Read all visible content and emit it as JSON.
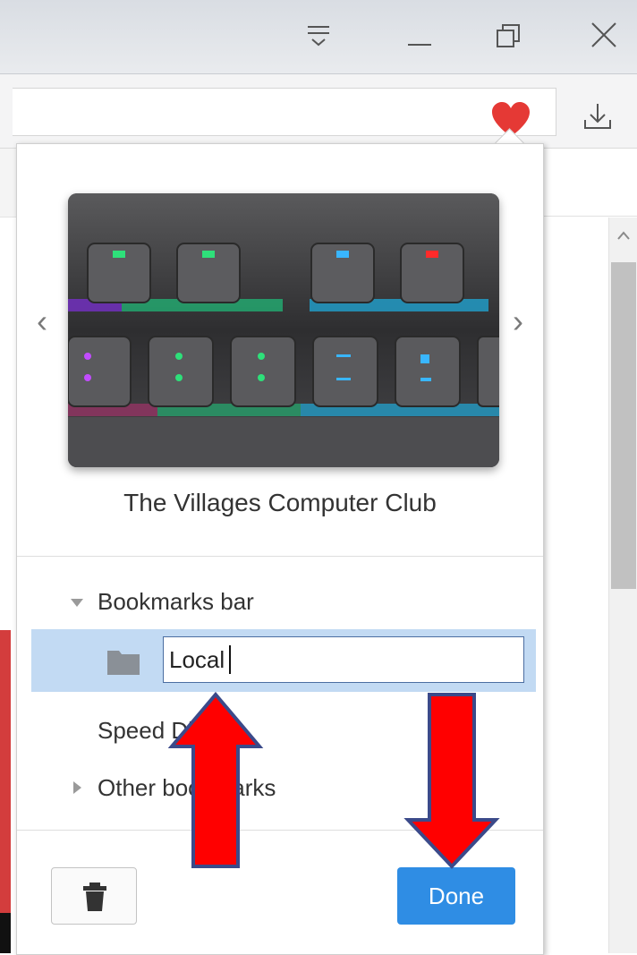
{
  "window": {
    "controls": [
      "menu-icon",
      "minimize-icon",
      "restore-icon",
      "close-icon"
    ]
  },
  "toolbar": {
    "bookmark_icon": "heart-icon",
    "download_icon": "download-icon",
    "bookmark_color": "#e53935"
  },
  "bookmark_popup": {
    "title": "The Villages Computer Club",
    "thumbnail_icon": "keyboard-thumbnail",
    "prev_glyph": "‹",
    "next_glyph": "›",
    "tree": {
      "parent_label": "Bookmarks bar",
      "folder_value": "Local",
      "speed_dial_label": "Speed Dial",
      "other_label": "Other bookmarks"
    },
    "delete_icon": "trash-icon",
    "done_label": "Done",
    "accent": "#2f8de4",
    "selection": "#c2daf3"
  },
  "annotations": {
    "arrow_color": "#ff0000",
    "arrows": [
      "up-arrow-to-folder-input",
      "down-arrow-to-done-button"
    ]
  }
}
